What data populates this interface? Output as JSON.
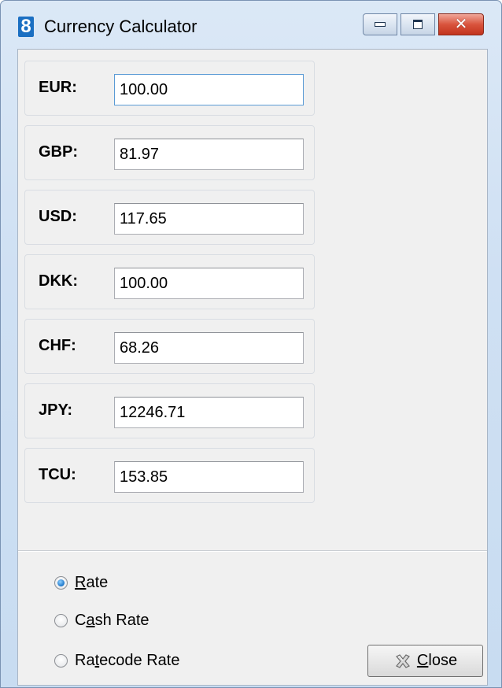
{
  "window": {
    "title": "Currency Calculator",
    "app_icon_text": "8",
    "buttons": {
      "minimize": "minimize",
      "maximize": "maximize",
      "close_glyph": "✕"
    }
  },
  "currencies": [
    {
      "code": "EUR:",
      "value": "100.00",
      "selected": true
    },
    {
      "code": "GBP:",
      "value": "81.97",
      "selected": false
    },
    {
      "code": "USD:",
      "value": "117.65",
      "selected": false
    },
    {
      "code": "DKK:",
      "value": "100.00",
      "selected": false
    },
    {
      "code": "CHF:",
      "value": "68.26",
      "selected": false
    },
    {
      "code": "JPY:",
      "value": "12246.71",
      "selected": false
    },
    {
      "code": "TCU:",
      "value": "153.85",
      "selected": false
    }
  ],
  "rate_options": {
    "rate": {
      "pre": "",
      "accel": "R",
      "post": "ate",
      "checked": true
    },
    "cash_rate": {
      "pre": "C",
      "accel": "a",
      "post": "sh Rate",
      "checked": false
    },
    "ratecode_rate": {
      "pre": "Ra",
      "accel": "t",
      "post": "ecode Rate",
      "checked": false
    }
  },
  "close_button": {
    "accel": "C",
    "post": "lose",
    "icon": "close-x-icon"
  },
  "colors": {
    "frame": "#c8dcf1",
    "client": "#f0f0f0",
    "selection": "#3399ff",
    "close_caption": "#c2331d"
  }
}
